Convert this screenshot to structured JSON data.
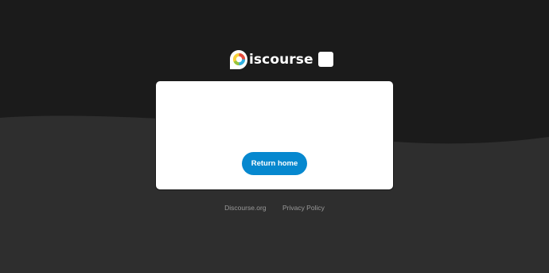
{
  "logo": {
    "text": "iscourse"
  },
  "card": {
    "button_label": "Return home"
  },
  "footer": {
    "links": [
      {
        "label": "Discourse.org"
      },
      {
        "label": "Privacy Policy"
      }
    ]
  },
  "colors": {
    "background_top": "#1b1b1b",
    "background_bottom": "#2e2e2e",
    "button": "#0688cf",
    "card": "#ffffff",
    "footer_link": "#9a9a9a"
  },
  "icons": [
    "discourse-logo-icon"
  ]
}
